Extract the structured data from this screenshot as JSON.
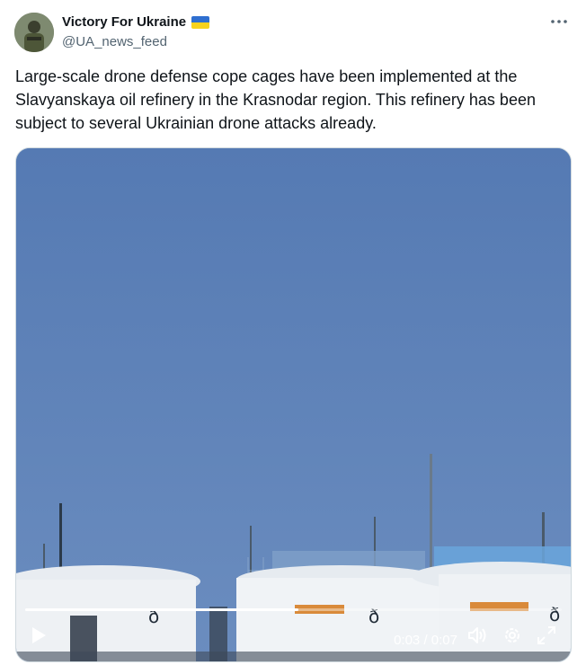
{
  "author": {
    "name": "Victory For Ukraine",
    "handle": "@UA_news_feed"
  },
  "tweet": {
    "text": "Large-scale drone defense cope cages have been implemented at the Slavyanskaya oil refinery in the Krasnodar region. This refinery has been subject to several Ukrainian drone attacks already."
  },
  "video": {
    "current_time": "0:03",
    "duration": "0:07",
    "time_separator": "/",
    "progress_fraction": 0.51
  },
  "colors": {
    "sky": "#5b7db3",
    "accent": "#1d9bf0",
    "text_primary": "#0f1419",
    "text_secondary": "#536471"
  },
  "icons": {
    "more": "more-icon",
    "play": "play-icon",
    "volume": "volume-icon",
    "settings": "gear-icon",
    "fullscreen": "fullscreen-icon"
  }
}
